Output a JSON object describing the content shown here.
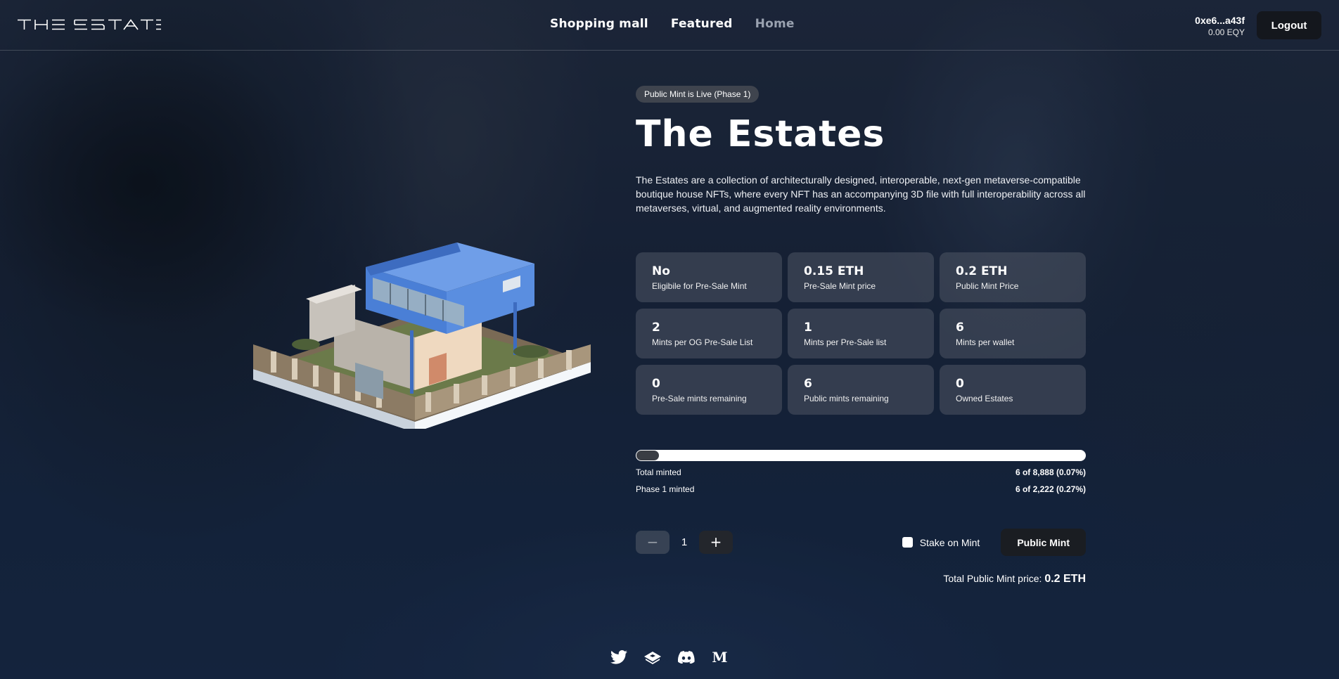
{
  "header": {
    "logo_text": "THE ESTATES",
    "nav": [
      {
        "label": "Shopping mall",
        "active": false
      },
      {
        "label": "Featured",
        "active": false
      },
      {
        "label": "Home",
        "active": true
      }
    ],
    "wallet_address": "0xe6...a43f",
    "wallet_balance": "0.00 EQY",
    "logout_label": "Logout"
  },
  "main": {
    "badge": "Public Mint is Live (Phase 1)",
    "title": "The Estates",
    "description": "The Estates are a collection of architecturally designed, interoperable, next-gen metaverse-compatible boutique house NFTs, where every NFT has an accompanying 3D file with full interoperability across all metaverses, virtual, and augmented reality environments.",
    "stats": [
      {
        "value": "No",
        "label": "Eligibile for Pre-Sale Mint"
      },
      {
        "value": "0.15 ETH",
        "label": "Pre-Sale Mint price"
      },
      {
        "value": "0.2 ETH",
        "label": "Public Mint Price"
      },
      {
        "value": "2",
        "label": "Mints per OG Pre-Sale List"
      },
      {
        "value": "1",
        "label": "Mints per Pre-Sale list"
      },
      {
        "value": "6",
        "label": "Mints per wallet"
      },
      {
        "value": "0",
        "label": "Pre-Sale mints remaining"
      },
      {
        "value": "6",
        "label": "Public mints remaining"
      },
      {
        "value": "0",
        "label": "Owned Estates"
      }
    ],
    "progress_percent": 0.07,
    "total_minted_label": "Total minted",
    "total_minted_value": "6 of 8,888 (0.07%)",
    "phase_minted_label": "Phase 1 minted",
    "phase_minted_value": "6 of 2,222 (0.27%)",
    "quantity": "1",
    "minus_symbol": "−",
    "plus_symbol": "+",
    "stake_label": "Stake on Mint",
    "mint_button": "Public Mint",
    "total_price_label": "Total Public Mint price:",
    "total_price_value": "0.2 ETH"
  },
  "footer": {
    "socials": [
      "twitter-icon",
      "opensea-ship-icon",
      "discord-icon",
      "medium-icon"
    ],
    "medium_letter": "M"
  },
  "colors": {
    "accent_blue": "#4a7fd6",
    "button_dark": "#14171d"
  }
}
